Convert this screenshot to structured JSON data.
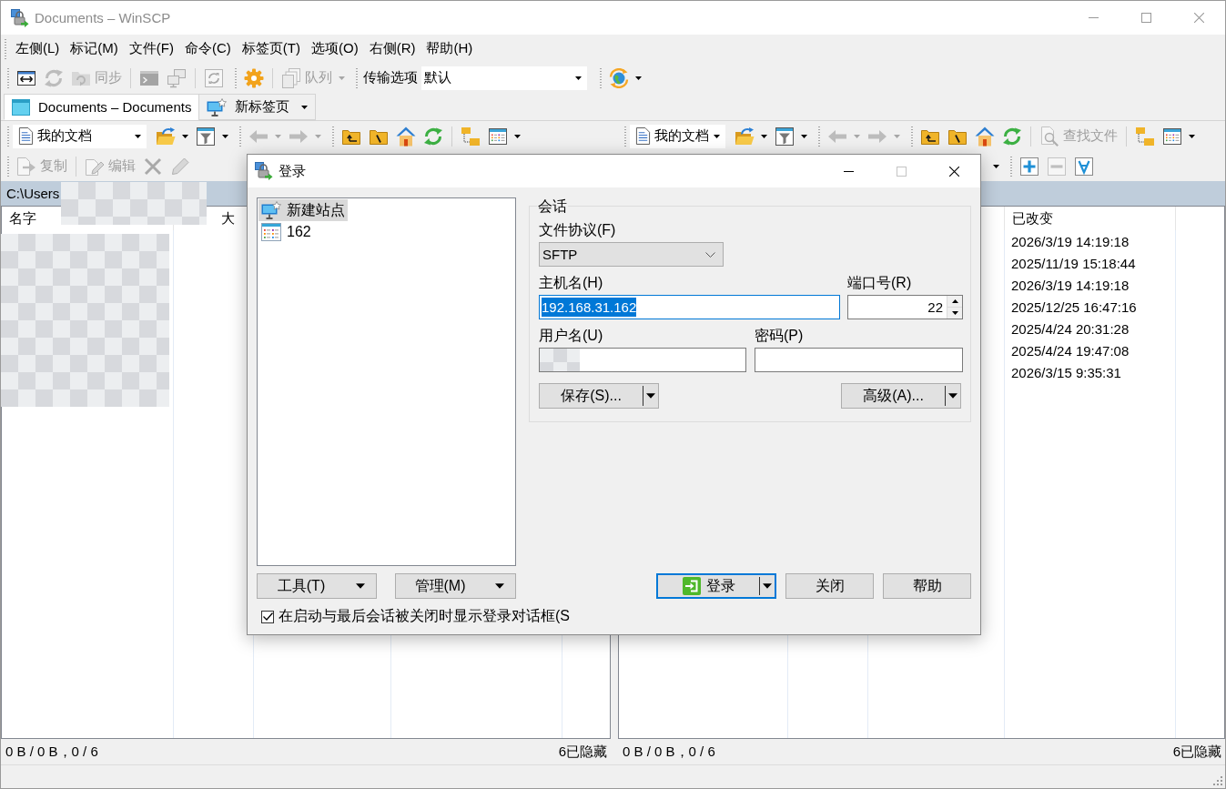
{
  "window": {
    "title": "Documents – WinSCP",
    "active": false
  },
  "menu": [
    "左侧(L)",
    "标记(M)",
    "文件(F)",
    "命令(C)",
    "标签页(T)",
    "选项(O)",
    "右侧(R)",
    "帮助(H)"
  ],
  "main_toolbar": [
    [
      [
        {
          "kind": "button",
          "disabled": false,
          "dropdown": false
        },
        {
          "kind": "button",
          "disabled": true,
          "dropdown": false
        },
        {
          "kind": "button",
          "label": "同步",
          "disabled": true,
          "dropdown": false
        }
      ],
      [
        {
          "kind": "button",
          "disabled": true,
          "dropdown": false
        },
        {
          "kind": "button",
          "disabled": true,
          "dropdown": false
        }
      ],
      [
        {
          "kind": "button",
          "disabled": true,
          "dropdown": false
        }
      ]
    ],
    [
      [
        {
          "kind": "button",
          "disabled": false,
          "dropdown": false
        }
      ],
      [
        {
          "kind": "button",
          "label": "队列",
          "disabled": true,
          "dropdown": true
        }
      ]
    ],
    [
      [
        {
          "kind": "label",
          "text": "传输选项"
        },
        {
          "kind": "select",
          "value": "默认"
        }
      ]
    ],
    [
      [
        {
          "kind": "button",
          "disabled": false,
          "dropdown": true
        }
      ]
    ]
  ],
  "tabs": [
    {
      "label": "Documents – Documents",
      "kind": "local",
      "selected": true,
      "dropdown": false
    },
    {
      "label": "新标签页",
      "kind": "new",
      "selected": false,
      "dropdown": true
    }
  ],
  "panels": [
    {
      "toolbar": [
        [
          [
            {
              "kind": "location",
              "value": "我的文档"
            },
            {
              "kind": "button",
              "disabled": false,
              "dropdown": true
            },
            {
              "kind": "button",
              "disabled": false,
              "dropdown": true
            }
          ]
        ],
        [
          [
            {
              "kind": "button",
              "disabled": true,
              "dropdown": true
            },
            {
              "kind": "button",
              "disabled": true,
              "dropdown": true
            }
          ]
        ],
        [
          [
            {
              "kind": "button",
              "disabled": false,
              "dropdown": false
            },
            {
              "kind": "button",
              "disabled": false,
              "dropdown": false
            },
            {
              "kind": "button",
              "disabled": false,
              "dropdown": false
            },
            {
              "kind": "button",
              "disabled": false,
              "dropdown": false
            }
          ],
          [
            {
              "kind": "button",
              "disabled": false,
              "dropdown": false
            },
            {
              "kind": "button",
              "disabled": false,
              "dropdown": true
            }
          ]
        ]
      ],
      "toolbar_2": [
        [
          [
            {
              "kind": "button",
              "label": "复制",
              "disabled": true,
              "dropdown": false
            }
          ],
          [
            {
              "kind": "button",
              "label": "编辑",
              "disabled": true,
              "dropdown": false
            },
            {
              "kind": "button",
              "disabled": true,
              "dropdown": false
            },
            {
              "kind": "button",
              "disabled": true,
              "dropdown": false
            }
          ]
        ]
      ],
      "path": "C:\\Users",
      "columns": [
        "名字",
        "大",
        null,
        null
      ],
      "status": {
        "selection": "0 B / 0 B，0 / 6",
        "hidden": "6已隐藏"
      }
    },
    {
      "toolbar": [
        [
          [
            {
              "kind": "location",
              "value": "我的文档"
            },
            {
              "kind": "button",
              "disabled": false,
              "dropdown": true
            },
            {
              "kind": "button",
              "disabled": false,
              "dropdown": true
            }
          ]
        ],
        [
          [
            {
              "kind": "button",
              "disabled": true,
              "dropdown": true
            },
            {
              "kind": "button",
              "disabled": true,
              "dropdown": true
            }
          ]
        ],
        [
          [
            {
              "kind": "button",
              "disabled": false,
              "dropdown": false
            },
            {
              "kind": "button",
              "disabled": false,
              "dropdown": false
            },
            {
              "kind": "button",
              "disabled": false,
              "dropdown": false
            },
            {
              "kind": "button",
              "disabled": false,
              "dropdown": false
            }
          ],
          [
            {
              "kind": "button",
              "label": "查找文件",
              "disabled": true,
              "dropdown": false
            }
          ],
          [
            {
              "kind": "button",
              "disabled": false,
              "dropdown": false
            },
            {
              "kind": "button",
              "disabled": false,
              "dropdown": true
            }
          ]
        ]
      ],
      "toolbar_2": [
        [
          [
            {
              "kind": "caret",
              "disabled": false
            }
          ]
        ],
        [
          [
            {
              "kind": "button",
              "disabled": false,
              "dropdown": false
            },
            {
              "kind": "button",
              "disabled": true,
              "dropdown": false
            },
            {
              "kind": "button",
              "disabled": false,
              "dropdown": false
            }
          ]
        ]
      ],
      "columns": [
        null,
        null,
        null,
        "已改变"
      ],
      "rows": [
        {
          "modified": "2026/3/19 14:19:18"
        },
        {
          "modified": "2025/11/19 15:18:44"
        },
        {
          "modified": "2026/3/19 14:19:18"
        },
        {
          "modified": "2025/12/25 16:47:16"
        },
        {
          "modified": "2025/4/24 20:31:28"
        },
        {
          "modified": "2025/4/24 19:47:08"
        },
        {
          "modified": "2026/3/15 9:35:31"
        }
      ],
      "status": {
        "selection": "0 B / 0 B，0 / 6",
        "hidden": "6已隐藏"
      }
    }
  ],
  "login_dialog": {
    "title": "登录",
    "controls": [
      {
        "kind": "minimize",
        "disabled": false
      },
      {
        "kind": "maximize",
        "disabled": true
      },
      {
        "kind": "close",
        "disabled": false
      }
    ],
    "sites": [
      {
        "label": "新建站点",
        "kind": "new",
        "selected": true
      },
      {
        "label": "162",
        "kind": "site",
        "selected": false
      }
    ],
    "tree_buttons": [
      {
        "label": "工具(T)",
        "dropdown": true
      },
      {
        "label": "管理(M)",
        "dropdown": true
      }
    ],
    "show_on_startup": {
      "label": "在启动与最后会话被关闭时显示登录对话框(S",
      "checked": true
    },
    "session": {
      "title": "会话",
      "protocol": {
        "label": "文件协议(F)",
        "value": "SFTP"
      },
      "host": {
        "label": "主机名(H)",
        "value": "192.168.31.162",
        "focused": true
      },
      "port": {
        "label": "端口号(R)",
        "value": "22"
      },
      "user": {
        "label": "用户名(U)"
      },
      "password": {
        "label": "密码(P)"
      },
      "buttons": [
        {
          "label": "保存(S)...",
          "dropdown": true
        },
        {
          "label": "高级(A)...",
          "dropdown": true
        }
      ]
    },
    "buttons": [
      {
        "label": "登录",
        "kind": "login",
        "default": true,
        "dropdown": true
      },
      {
        "label": "关闭",
        "kind": "plain",
        "default": false,
        "dropdown": false
      },
      {
        "label": "帮助",
        "kind": "plain",
        "default": false,
        "dropdown": false
      }
    ]
  }
}
